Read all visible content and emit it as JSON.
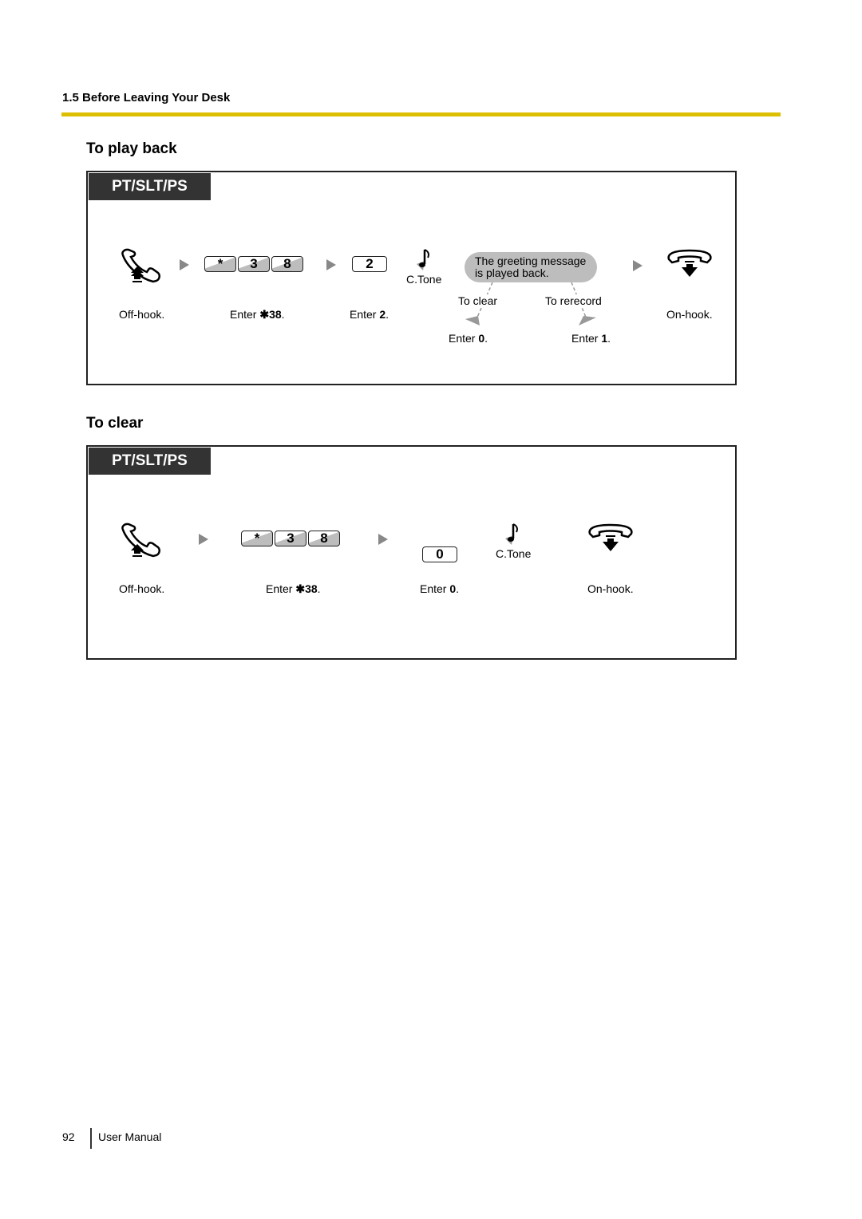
{
  "header": {
    "section": "1.5 Before Leaving Your Desk",
    "rule_color": "#dcbf00"
  },
  "sections": [
    {
      "title": "To play back",
      "badge": "PT/SLT/PS",
      "steps": {
        "offhook": "Off-hook.",
        "keys": [
          "*",
          "3",
          "8"
        ],
        "enter_keys_prefix": "Enter ",
        "enter_keys_value": "✱38",
        "key2": "2",
        "enter2_prefix": "Enter ",
        "enter2_value": "2",
        "ctone": "C.Tone",
        "bubble_line1": "The greeting message",
        "bubble_line2": "is played back.",
        "branch_clear_label": "To clear",
        "branch_rerecord_label": "To rerecord",
        "enter0_prefix": "Enter ",
        "enter0_value": "0",
        "enter1_prefix": "Enter ",
        "enter1_value": "1",
        "onhook": "On-hook."
      }
    },
    {
      "title": "To clear",
      "badge": "PT/SLT/PS",
      "steps": {
        "offhook": "Off-hook.",
        "keys": [
          "*",
          "3",
          "8"
        ],
        "enter_keys_prefix": "Enter ",
        "enter_keys_value": "✱38",
        "key0": "0",
        "enter0_prefix": "Enter ",
        "enter0_value": "0",
        "ctone": "C.Tone",
        "onhook": "On-hook."
      }
    }
  ],
  "icons": {
    "offhook": "handset-offhook-icon",
    "onhook": "handset-onhook-icon",
    "tone": "music-note-icon",
    "arrow": "right-triangle-arrow-icon"
  },
  "footer": {
    "page_number": "92",
    "doc_title": "User Manual"
  }
}
